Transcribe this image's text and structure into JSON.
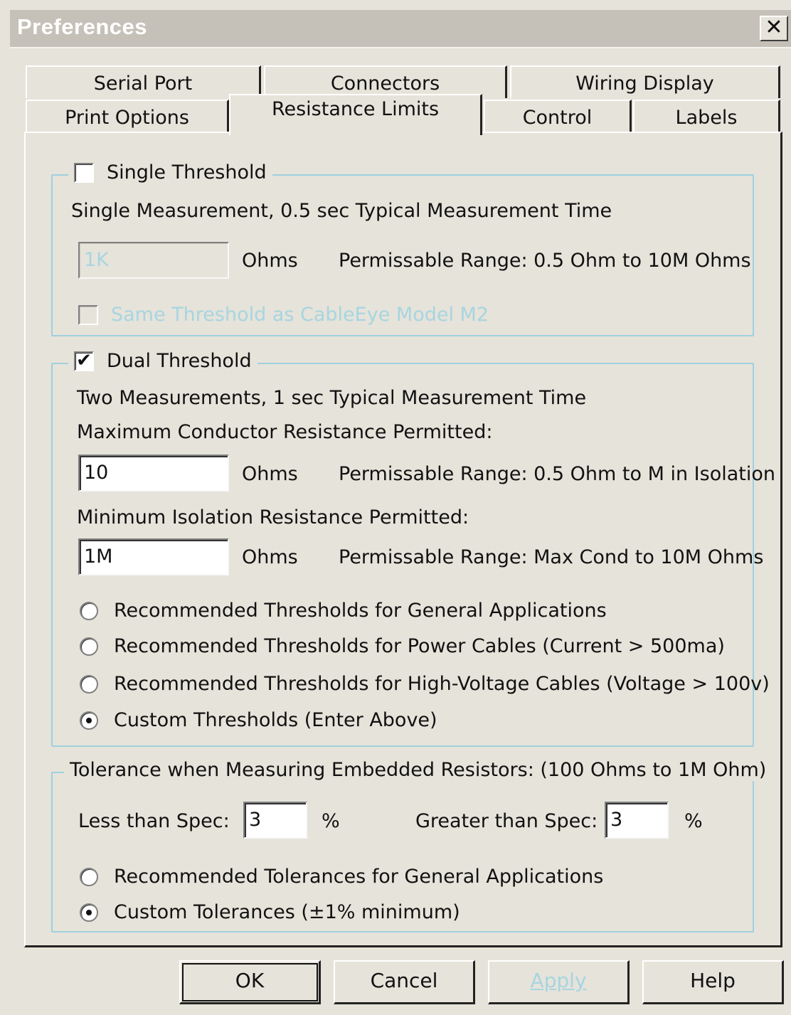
{
  "window": {
    "title": "Preferences",
    "close_glyph": "✕"
  },
  "tabs": {
    "row1": [
      "Serial Port",
      "Connectors",
      "Wiring Display"
    ],
    "row2": [
      "Print Options",
      "Resistance Limits",
      "Control",
      "Labels"
    ],
    "active": "Resistance Limits"
  },
  "single_threshold": {
    "label": "Single Threshold",
    "checked": false,
    "description": "Single Measurement, 0.5 sec Typical Measurement Time",
    "value": "1K",
    "unit": "Ohms",
    "range": "Permissable Range: 0.5 Ohm to 10M Ohms",
    "same_threshold_label": "Same Threshold as CableEye Model M2"
  },
  "dual_threshold": {
    "label": "Dual Threshold",
    "checked": true,
    "checkmark_glyph": "✔",
    "description": "Two Measurements, 1 sec Typical Measurement Time",
    "max_label": "Maximum Conductor Resistance Permitted:",
    "max_value": "10",
    "max_unit": "Ohms",
    "max_range": "Permissable Range: 0.5 Ohm to M in Isolation",
    "min_label": "Minimum Isolation Resistance Permitted:",
    "min_value": "1M",
    "min_unit": "Ohms",
    "min_range": "Permissable Range: Max Cond to 10M Ohms",
    "options": [
      {
        "label": "Recommended Thresholds for General Applications",
        "selected": false
      },
      {
        "label": "Recommended Thresholds for Power Cables (Current > 500ma)",
        "selected": false
      },
      {
        "label": "Recommended Thresholds for High-Voltage Cables (Voltage > 100v)",
        "selected": false
      },
      {
        "label": "Custom Thresholds (Enter Above)",
        "selected": true
      }
    ]
  },
  "tolerance": {
    "legend": "Tolerance when Measuring Embedded Resistors: (100 Ohms to 1M Ohm)",
    "less_label": "Less than Spec:",
    "less_value": "3",
    "less_unit": "%",
    "greater_label": "Greater than Spec:",
    "greater_value": "3",
    "greater_unit": "%",
    "options": [
      {
        "label": "Recommended Tolerances for General Applications",
        "selected": false
      },
      {
        "label": "Custom Tolerances (±1% minimum)",
        "selected": true
      }
    ]
  },
  "buttons": {
    "ok": "OK",
    "cancel": "Cancel",
    "apply": "Apply",
    "help": "Help"
  },
  "colors": {
    "dialog_bg": "#e6e3da",
    "titlebar_bg": "#c5c1b8",
    "group_border": "#9fd0de",
    "disabled_text": "#a7d5e0"
  }
}
